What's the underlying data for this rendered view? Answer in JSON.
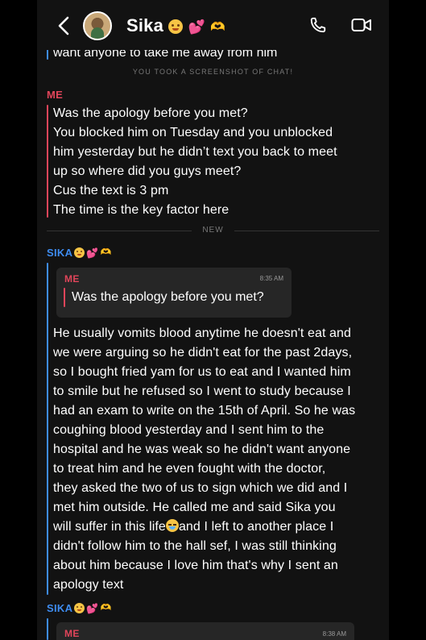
{
  "header": {
    "contact_name": "Sika",
    "emojis": [
      "flushed-face-emoji",
      "two-hearts-emoji",
      "heart-hands-emoji"
    ],
    "icons": [
      "back-chevron-icon",
      "avatar",
      "phone-icon",
      "video-camera-icon"
    ]
  },
  "clipped_top_text": "want anyone to take me away from him",
  "screenshot_notice": "YOU TOOK A SCREENSHOT OF CHAT!",
  "message_me": {
    "sender": "ME",
    "lines": [
      "Was the apology before you met?",
      "You blocked him on Tuesday and you unblocked",
      "him yesterday  but he didn’t text you back to meet",
      "up so where did you guys meet?",
      "Cus the text is 3 pm",
      "The time is the key factor here"
    ]
  },
  "new_divider": "NEW",
  "message_sika": {
    "sender": "SIKA",
    "quote": {
      "label": "ME",
      "time": "8:35 AM",
      "text": "Was the apology before you met?"
    },
    "lines": [
      "He usually vomits blood anytime he doesn't eat and",
      "we were arguing so he didn't eat for the past 2days,",
      "so I bought fried yam for us to eat and I wanted him",
      "to smile but he refused so I went to study because I",
      "had an exam to write on the 15th of April. So he was",
      "coughing blood yesterday and I sent him to the",
      "hospital and he was weak so he didn't want anyone",
      "to treat him and he even fought with the doctor,",
      "they asked the two of us to sign which we did and I",
      "met him outside.  He called me and said Sika you",
      "will suffer in this life",
      "and I left to another place I",
      "didn't follow him to the hall sef, I was still thinking",
      "about him because I love him that's why I sent an",
      "apology text"
    ]
  },
  "message_sika_2": {
    "sender": "SIKA",
    "quote": {
      "label": "ME",
      "time": "8:38 AM"
    }
  },
  "colors": {
    "background": "#121212",
    "me_accent": "#e0455a",
    "sika_accent": "#3e8cf0",
    "quote_bg": "#262626"
  }
}
